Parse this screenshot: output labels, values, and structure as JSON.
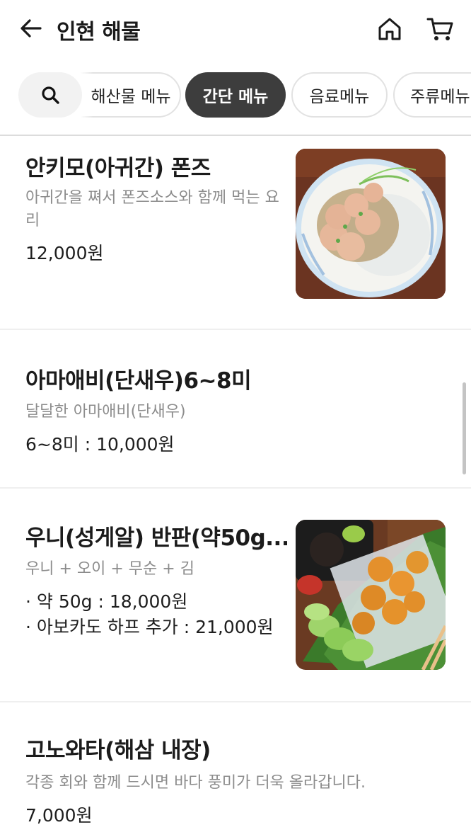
{
  "header": {
    "title": "인현 해물",
    "back_icon": "arrow-left-icon",
    "home_icon": "home-icon",
    "cart_icon": "cart-icon"
  },
  "categories": {
    "search_icon": "search-icon",
    "tabs": [
      {
        "label": "해산물 메뉴",
        "active": false
      },
      {
        "label": "간단 메뉴",
        "active": true
      },
      {
        "label": "음료메뉴",
        "active": false
      },
      {
        "label": "주류메뉴",
        "active": false
      }
    ]
  },
  "menu": {
    "items": [
      {
        "name": "안키모(아귀간) 폰즈",
        "description": "아귀간을 쪄서 폰즈소스와 함께 먹는 요리",
        "price_lines": [
          "12,000원"
        ],
        "has_image": true
      },
      {
        "name": "아마애비(단새우)6~8미",
        "description": "달달한 아마애비(단새우)",
        "price_lines": [
          "6~8미 : 10,000원"
        ],
        "has_image": false
      },
      {
        "name": "우니(성게알) 반판(약50g...",
        "description": "우니 + 오이 + 무순 + 김",
        "price_lines": [
          "· 약 50g : 18,000원",
          "· 아보카도 하프 추가 : 21,000원"
        ],
        "has_image": true
      },
      {
        "name": "고노와타(해삼 내장)",
        "description": "각종 회와 함께 드시면 바다 풍미가 더욱 올라갑니다.",
        "price_lines": [
          "7,000원"
        ],
        "has_image": false
      }
    ]
  },
  "colors": {
    "active_chip": "#3d3d3d",
    "desc_gray": "#8c8c8c",
    "divider": "#efefef"
  }
}
